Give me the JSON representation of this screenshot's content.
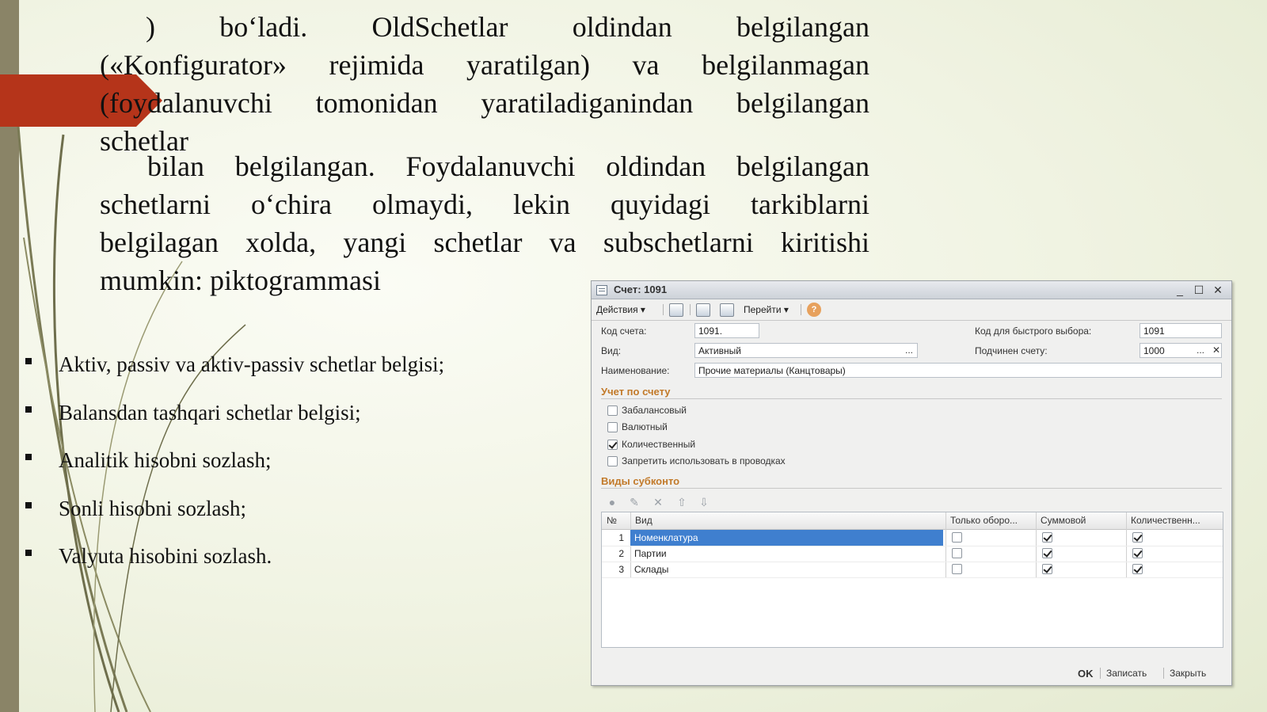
{
  "slide": {
    "para1": {
      "lines": [
        ")   bo‘ladi.   OldSchetlar   oldindan   belgilangan",
        "(«Konfigurator» rejimida yaratilgan)    va belgilanmagan",
        "(foydalanuvchi tomonidan yaratiladiganindan belgilangan",
        "schetlar"
      ]
    },
    "para2": {
      "lines": [
        "bilan belgilangan. Foydalanuvchi oldindan belgilangan",
        "schetlarni o‘chira olmaydi, lekin quyidagi tarkiblarni",
        "belgilagan xolda, yangi schetlar va subschetlarni kiritishi",
        "mumkin: piktogrammasi"
      ]
    },
    "bullets": [
      "Aktiv, passiv va aktiv-passiv schetlar belgisi;",
      "Balansdan tashqari schetlar belgisi;",
      "Analitik hisobni sozlash;",
      "Sonli hisobni sozlash;",
      "Valyuta hisobini sozlash."
    ],
    "colors": {
      "accent_red": "#b5341a",
      "left_bar": "#8a8467",
      "grid_selection": "#3f7fcf",
      "section_header": "#c27a2a"
    }
  },
  "window": {
    "title": "Счет: 1091",
    "toolbar": {
      "actions": "Действия ▾",
      "goto": "Перейти ▾",
      "help": "?"
    },
    "form": {
      "code_label": "Код счета:",
      "code_value": "1091.",
      "quick_label": "Код для быстрого выбора:",
      "quick_value": "1091",
      "kind_label": "Вид:",
      "kind_value": "Активный",
      "kind_dots": "...",
      "parent_label": "Подчинен счету:",
      "parent_value": "1000",
      "parent_dots": "...",
      "parent_clear": "✕",
      "name_label": "Наименование:",
      "name_value": "Прочие материалы (Канцтовары)"
    },
    "accounting": {
      "title": "Учет по счету",
      "options": [
        {
          "label": "Забалансовый",
          "checked": false
        },
        {
          "label": "Валютный",
          "checked": false
        },
        {
          "label": "Количественный",
          "checked": true
        },
        {
          "label": "Запретить использовать в проводках",
          "checked": false
        }
      ]
    },
    "subconto": {
      "title": "Виды субконто",
      "columns": [
        "№",
        "Вид",
        "Только оборо...",
        "Суммовой",
        "Количественн..."
      ],
      "rows": [
        {
          "n": "1",
          "kind": "Номенклатура",
          "only_turnover": false,
          "sum": true,
          "qty": true
        },
        {
          "n": "2",
          "kind": "Партии",
          "only_turnover": false,
          "sum": true,
          "qty": true
        },
        {
          "n": "3",
          "kind": "Склады",
          "only_turnover": false,
          "sum": true,
          "qty": true
        }
      ]
    },
    "footer": {
      "ok": "OK",
      "save": "Записать",
      "close": "Закрыть"
    }
  }
}
